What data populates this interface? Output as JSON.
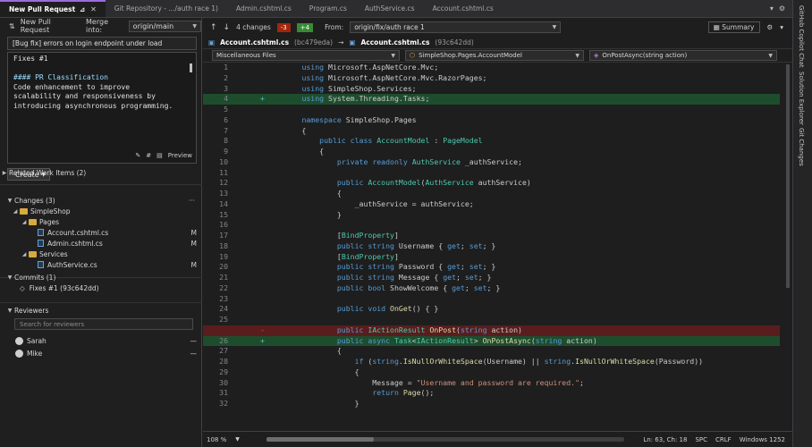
{
  "tabs": [
    {
      "label": "New Pull Request",
      "active": true
    },
    {
      "label": "Git Repository - .../auth race 1)"
    },
    {
      "label": "Admin.cshtml.cs"
    },
    {
      "label": "Program.cs"
    },
    {
      "label": "AuthService.cs"
    },
    {
      "label": "Account.cshtml.cs"
    }
  ],
  "right_rail": {
    "label1": "GitHub Copilot Chat",
    "label2": "Solution Explorer",
    "label3": "Git Changes"
  },
  "left": {
    "new_pr_label": "New Pull Request",
    "merge_into_label": "Merge into:",
    "merge_into_value": "origin/main",
    "title_value": "[Bug fix] errors on login endpoint under load",
    "description_lines": [
      {
        "text": "Fixes #1",
        "cls": ""
      },
      {
        "text": "",
        "cls": ""
      },
      {
        "text": "#### PR Classification",
        "cls": "gray"
      },
      {
        "text": "Code enhancement to improve",
        "cls": ""
      },
      {
        "text": "scalability and responsiveness by",
        "cls": ""
      },
      {
        "text": "introducing asynchronous programming.",
        "cls": ""
      }
    ],
    "preview_label": "Preview",
    "create_label": "Create",
    "related_items": "Related Work Items (2)",
    "changes": "Changes (3)",
    "tree": {
      "root": "SimpleShop",
      "pages": "Pages",
      "file1": "Account.cshtml.cs",
      "file2": "Admin.cshtml.cs",
      "services": "Services",
      "file3": "AuthService.cs",
      "flag": "M"
    },
    "commits": "Commits (1)",
    "commit_item": "Fixes #1 (93c642dd)",
    "reviewers": "Reviewers",
    "reviewer_placeholder": "Search for reviewers",
    "reviewer1": "Sarah",
    "reviewer2": "Mike",
    "dash": "—"
  },
  "main": {
    "changes_count": "4 changes",
    "removed": "-3",
    "added": "+4",
    "from_label": "From:",
    "from_value": "origin/fix/auth race 1",
    "summary_label": "Summary",
    "file_left": "Account.cshtml.cs",
    "hash_left": "(bc479eda)",
    "file_right": "Account.cshtml.cs",
    "hash_right": "(93c642dd)",
    "scope1": "Miscellaneous Files",
    "scope2": "SimpleShop.Pages.AccountModel",
    "scope3": "OnPostAsync(string action)"
  },
  "code_lines": [
    {
      "n": "1",
      "m": "",
      "t": "        using Microsoft.AspNetCore.Mvc;",
      "k": ""
    },
    {
      "n": "2",
      "m": "",
      "t": "        using Microsoft.AspNetCore.Mvc.RazorPages;",
      "k": ""
    },
    {
      "n": "3",
      "m": "",
      "t": "        using SimpleShop.Services;",
      "k": ""
    },
    {
      "n": "4",
      "m": "+",
      "t": "        using System.Threading.Tasks;",
      "k": "add"
    },
    {
      "n": "5",
      "m": "",
      "t": "",
      "k": ""
    },
    {
      "n": "6",
      "m": "",
      "t": "        namespace SimpleShop.Pages",
      "k": ""
    },
    {
      "n": "7",
      "m": "",
      "t": "        {",
      "k": ""
    },
    {
      "n": "8",
      "m": "",
      "t": "            public class AccountModel : PageModel",
      "k": ""
    },
    {
      "n": "9",
      "m": "",
      "t": "            {",
      "k": ""
    },
    {
      "n": "10",
      "m": "",
      "t": "                private readonly AuthService _authService;",
      "k": ""
    },
    {
      "n": "11",
      "m": "",
      "t": "",
      "k": ""
    },
    {
      "n": "12",
      "m": "",
      "t": "                public AccountModel(AuthService authService)",
      "k": ""
    },
    {
      "n": "13",
      "m": "",
      "t": "                {",
      "k": ""
    },
    {
      "n": "14",
      "m": "",
      "t": "                    _authService = authService;",
      "k": ""
    },
    {
      "n": "15",
      "m": "",
      "t": "                }",
      "k": ""
    },
    {
      "n": "16",
      "m": "",
      "t": "",
      "k": ""
    },
    {
      "n": "17",
      "m": "",
      "t": "                [BindProperty]",
      "k": ""
    },
    {
      "n": "18",
      "m": "",
      "t": "                public string Username { get; set; }",
      "k": ""
    },
    {
      "n": "19",
      "m": "",
      "t": "                [BindProperty]",
      "k": ""
    },
    {
      "n": "20",
      "m": "",
      "t": "                public string Password { get; set; }",
      "k": ""
    },
    {
      "n": "21",
      "m": "",
      "t": "                public string Message { get; set; }",
      "k": ""
    },
    {
      "n": "22",
      "m": "",
      "t": "                public bool ShowWelcome { get; set; }",
      "k": ""
    },
    {
      "n": "23",
      "m": "",
      "t": "",
      "k": ""
    },
    {
      "n": "24",
      "m": "",
      "t": "                public void OnGet() { }",
      "k": ""
    },
    {
      "n": "25",
      "m": "",
      "t": "",
      "k": ""
    },
    {
      "n": "",
      "m": "-",
      "t": "                public IActionResult OnPost(string action)",
      "k": "del"
    },
    {
      "n": "26",
      "m": "+",
      "t": "                public async Task<IActionResult> OnPostAsync(string action)",
      "k": "add"
    },
    {
      "n": "27",
      "m": "",
      "t": "                {",
      "k": ""
    },
    {
      "n": "28",
      "m": "",
      "t": "                    if (string.IsNullOrWhiteSpace(Username) || string.IsNullOrWhiteSpace(Password))",
      "k": ""
    },
    {
      "n": "29",
      "m": "",
      "t": "                    {",
      "k": ""
    },
    {
      "n": "30",
      "m": "",
      "t": "                        Message = \"Username and password are required.\";",
      "k": ""
    },
    {
      "n": "31",
      "m": "",
      "t": "                        return Page();",
      "k": ""
    },
    {
      "n": "32",
      "m": "",
      "t": "                    }",
      "k": ""
    }
  ],
  "status": {
    "zoom": "108 %",
    "position": "Ln: 63, Ch: 18",
    "indent": "SPC",
    "eol": "CRLF",
    "encoding": "Windows 1252"
  },
  "colors": {
    "accent": "#9b6bdf",
    "added": "#1e4d2e",
    "removed": "#5a1d1d",
    "badge_removed": "#a1260d",
    "badge_added": "#388a34"
  }
}
